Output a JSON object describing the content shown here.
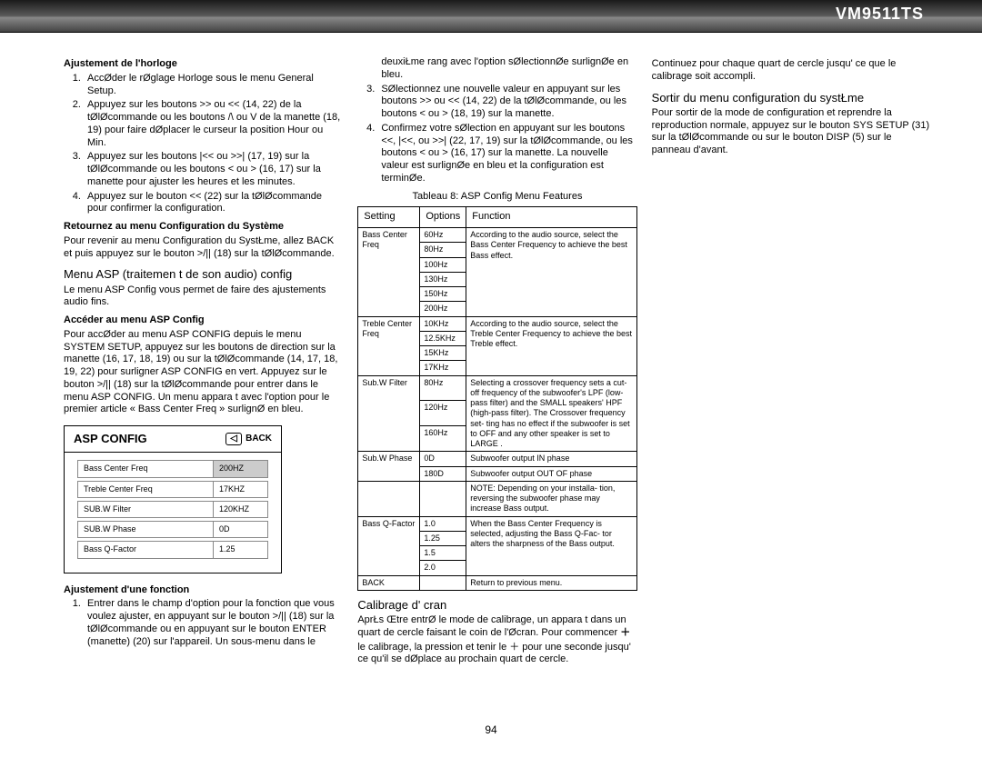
{
  "header": {
    "model": "VM9511TS"
  },
  "page_number": "94",
  "col1": {
    "h_clock": "Ajustement de l'horloge",
    "clock_items": [
      "AccØder le rØglage Horloge sous le menu General Setup.",
      "Appuyez sur les boutons >> ou << (14, 22) de la tØlØcommande ou les boutons /\\ ou V de la manette (18, 19) pour faire dØplacer le curseur   la position Hour ou Min.",
      "Appuyez sur les boutons |<< ou >>| (17, 19) sur la tØlØcommande ou les boutons < ou > (16, 17) sur la manette pour ajuster les heures et les minutes.",
      "Appuyez sur le bouton << (22) sur la tØlØcommande pour confirmer la configuration."
    ],
    "h_return": "Retournez au menu Configuration du Système",
    "p_return": "Pour revenir au menu Configuration du SystŁme, allez   BACK  et puis appuyez sur le bouton >/|| (18) sur la tØlØcommande.",
    "h_menu_asp": "Menu ASP (traitemen        t de son audio) config",
    "p_menu_asp": "Le menu ASP Config vous permet de faire des ajustements audio fins.",
    "h_access": "Accéder au menu ASP Config",
    "p_access": "Pour accØder au menu ASP CONFIG depuis le menu SYSTEM SETUP, appuyez sur les boutons de direction sur la manette (16, 17, 18, 19) ou sur la tØlØcommande (14, 17, 18, 19, 22) pour surligner ASP CONFIG en vert. Appuyez sur le bouton >/|| (18) sur la tØlØcommande pour entrer dans le menu ASP CONFIG. Un menu appara t avec l'option pour le premier article « Bass Center Freq » surlignØ en bleu.",
    "asp_box": {
      "title": "ASP CONFIG",
      "back": "BACK",
      "rows": [
        {
          "l": "Bass Center Freq",
          "r": "200HZ",
          "hl": true
        },
        {
          "l": "Treble Center Freq",
          "r": "17KHZ"
        },
        {
          "l": "SUB.W Filter",
          "r": "120KHZ"
        },
        {
          "l": "SUB.W Phase",
          "r": "0D"
        },
        {
          "l": "Bass Q-Factor",
          "r": "1.25"
        }
      ]
    },
    "h_adjust": "Ajustement d'une fonction",
    "adjust_items_partial": "Entrer dans le champ d'option pour la fonction que vous voulez ajuster, en appuyant sur le bouton >/|| (18) sur la tØlØcommande ou en appuyant sur le bouton ENTER (manette) (20) sur l'appareil. Un sous-menu dans le"
  },
  "col2": {
    "cont1": "deuxiŁme rang avec l'option sØlectionnØe surlignØe en bleu.",
    "li2": "SØlectionnez une nouvelle valeur en appuyant sur les boutons >> ou << (14, 22) de la tØlØcommande, ou les boutons < ou > (18, 19) sur la manette.",
    "li3": "Confirmez votre sØlection en appuyant sur les boutons <<, |<<, ou >>| (22, 17, 19) sur la tØlØcommande, ou les boutons < ou > (16, 17) sur la manette. La nouvelle valeur est surlignØe en bleu et la configuration est terminØe.",
    "table_caption": "Tableau 8: ASP Config Menu Features",
    "th": {
      "a": "Setting",
      "b": "Options",
      "c": "Function"
    },
    "rows": [
      {
        "s": "Bass Center Freq",
        "opts": [
          "60Hz",
          "80Hz",
          "100Hz",
          "130Hz",
          "150Hz",
          "200Hz"
        ],
        "fn": "According to the audio source, select the Bass Center Frequency to achieve the best Bass effect."
      },
      {
        "s": "Treble Center Freq",
        "opts": [
          "10KHz",
          "12.5KHz",
          "15KHz",
          "17KHz"
        ],
        "fn": "According to the audio source, select the Treble Center Frequency to achieve the best Treble effect."
      },
      {
        "s": "Sub.W Filter",
        "opts": [
          "80Hz",
          "120Hz",
          "160Hz"
        ],
        "fn": "Selecting a crossover frequency sets a cut-off frequency of the subwoofer's LPF (low-pass filter) and the  SMALL  speakers' HPF (high-pass filter). The Crossover frequency set- ting has no effect if the subwoofer is set to  OFF  and any other speaker is set to  LARGE ."
      },
      {
        "s": "Sub.W Phase",
        "opts": [
          "0D",
          "180D"
        ],
        "fn_rows": [
          "Subwoofer output IN phase",
          "Subwoofer output OUT OF phase"
        ],
        "note": "NOTE: Depending on your installa- tion, reversing the subwoofer phase may increase Bass output."
      },
      {
        "s": "Bass Q-Factor",
        "opts": [
          "1.0",
          "1.25",
          "1.5",
          "2.0"
        ],
        "fn": "When the Bass Center Frequency is selected, adjusting the Bass Q-Fac- tor alters the sharpness of the Bass output."
      },
      {
        "s": "BACK",
        "opts": [
          ""
        ],
        "fn": "Return to previous menu."
      }
    ],
    "h_calib": "Calibrage d' cran",
    "p_calib1": "AprŁs Œtre entrØ le mode de calibrage, un     appara t dans un quart de cercle faisant le coin de l'Øcran. Pour commencer",
    "p_calib2": "le calibrage, la pression et tenir le ＋ pour une seconde jusqu'  ce qu'il se dØplace au prochain quart de cercle."
  },
  "col3": {
    "p_cont": "Continuez pour chaque quart de cercle jusqu'  ce que le calibrage soit accompli.",
    "h_exit": "Sortir du menu configuration du systŁme",
    "p_exit": "Pour sortir de la mode de configuration et reprendre la reproduction normale, appuyez sur le bouton SYS SETUP (31) sur la tØlØcommande ou sur le bouton DISP (5) sur le panneau d'avant."
  }
}
